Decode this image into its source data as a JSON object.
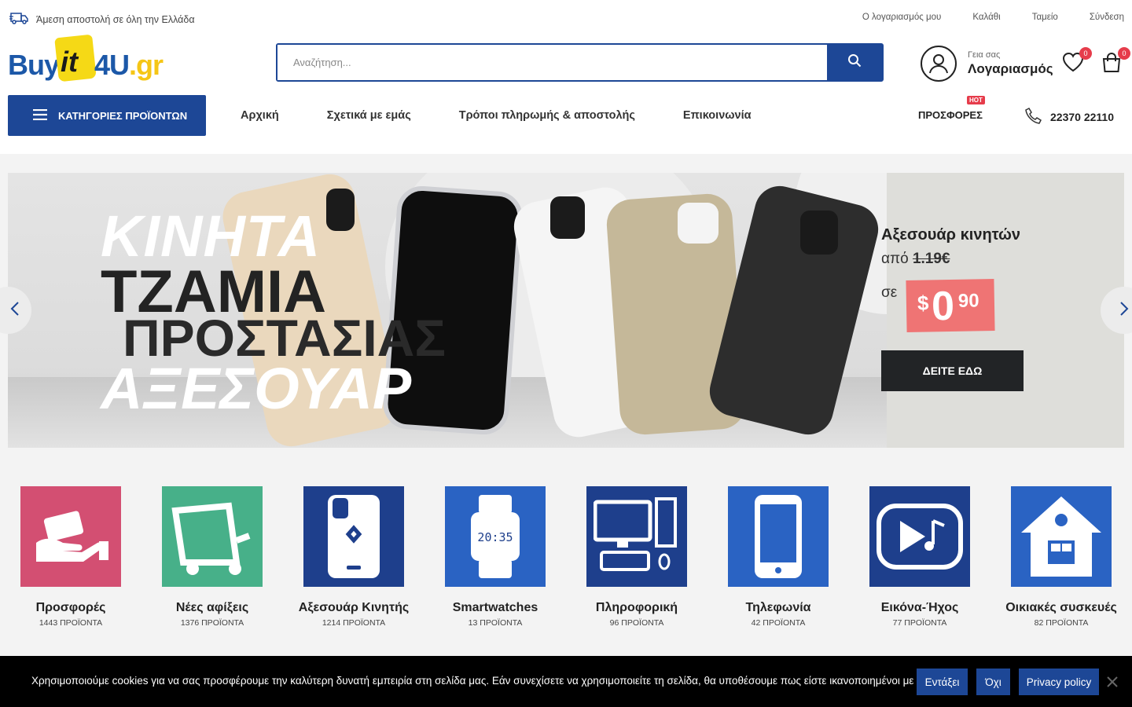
{
  "topbar": {
    "shipping_text": "Άμεση αποστολή σε όλη την Ελλάδα",
    "links": [
      "Ο λογαριασμός μου",
      "Καλάθι",
      "Ταμείο",
      "Σύνδεση"
    ]
  },
  "logo": {
    "part1": "Buy",
    "part2": "it",
    "part3": "4U",
    "part4": ".gr"
  },
  "search": {
    "placeholder": "Αναζήτηση..."
  },
  "account": {
    "greeting": "Γεια σας",
    "label": "Λογαριασμός"
  },
  "wishlist": {
    "count": "0"
  },
  "cart": {
    "count": "0"
  },
  "nav": {
    "categories_button": "ΚΑΤΗΓΟΡΙΕΣ ΠΡΟΪΟΝΤΩΝ",
    "items": [
      "Αρχική",
      "Σχετικά με εμάς",
      "Τρόποι πληρωμής & αποστολής",
      "Επικοινωνία"
    ],
    "offers": "ΠΡΟΣΦΟΡΕΣ",
    "hot_badge": "HOT",
    "phone": "22370 22110"
  },
  "hero": {
    "line1": "ΚΙΝΗΤΑ",
    "line2": "ΤΖΑΜΙΑ",
    "line3": "ΠΡΟΣΤΑΣΙΑΣ",
    "line4": "ΑΞΕΣΟΥΑΡ",
    "promo_title": "Αξεσουάρ κινητών",
    "from_label": "από",
    "old_price": "1.19€",
    "to_label": "σε",
    "price_currency": "$",
    "price_int": "0",
    "price_cents": "90",
    "cta": "ΔΕΙΤΕ ΕΔΩ"
  },
  "categories": [
    {
      "name": "Προσφορές",
      "count": "1443 ΠΡΟΪΟΝΤΑ",
      "color": "#d34f72",
      "icon": "wallet-hand-icon"
    },
    {
      "name": "Νέες αφίξεις",
      "count": "1376 ΠΡΟΪΟΝΤΑ",
      "color": "#47b089",
      "icon": "cart-icon"
    },
    {
      "name": "Αξεσουάρ Κινητής",
      "count": "1214 ΠΡΟΪΟΝΤΑ",
      "color": "#1e3f8c",
      "icon": "phone-case-icon"
    },
    {
      "name": "Smartwatches",
      "count": "13 ΠΡΟΪΟΝΤΑ",
      "color": "#2a63c3",
      "icon": "smartwatch-icon"
    },
    {
      "name": "Πληροφορική",
      "count": "96 ΠΡΟΪΟΝΤΑ",
      "color": "#1e3f8c",
      "icon": "computer-icon"
    },
    {
      "name": "Τηλεφωνία",
      "count": "42 ΠΡΟΪΟΝΤΑ",
      "color": "#2a63c3",
      "icon": "smartphone-icon"
    },
    {
      "name": "Εικόνα-Ήχος",
      "count": "77 ΠΡΟΪΟΝΤΑ",
      "color": "#1e3f8c",
      "icon": "media-icon"
    },
    {
      "name": "Οικιακές συσκευές",
      "count": "82 ΠΡΟΪΟΝΤΑ",
      "color": "#2a63c3",
      "icon": "home-appliances-icon"
    }
  ],
  "cookie": {
    "message": "Χρησιμοποιούμε cookies για να σας προσφέρουμε την καλύτερη δυνατή εμπειρία στη σελίδα μας. Εάν συνεχίσετε να χρησιμοποιείτε τη σελίδα, θα υποθέσουμε πως είστε ικανοποιημένοι με αυτό.",
    "accept": "Εντάξει",
    "decline": "Όχι",
    "policy": "Privacy policy"
  }
}
